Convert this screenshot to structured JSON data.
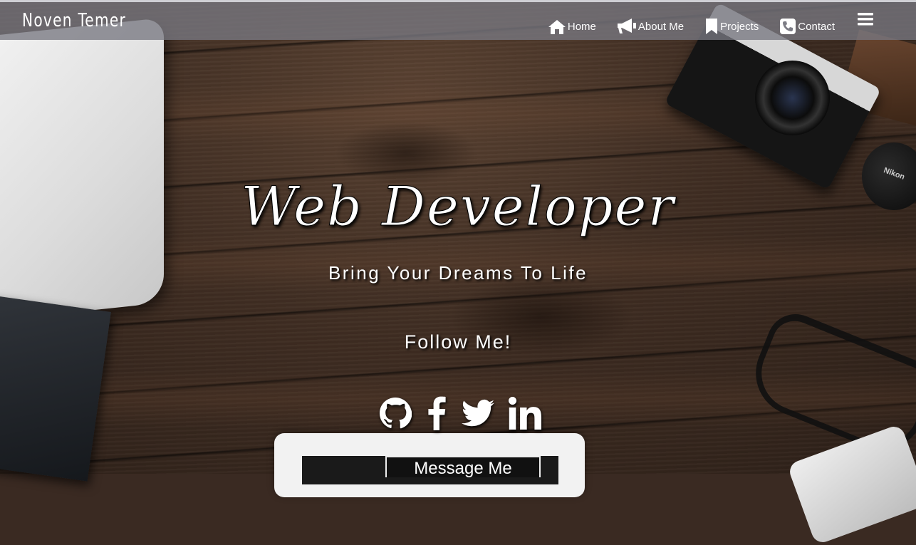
{
  "navbar": {
    "brand": "Noven Temer",
    "items": [
      {
        "label": "Home",
        "icon": "home-icon"
      },
      {
        "label": "About Me",
        "icon": "megaphone-icon"
      },
      {
        "label": "Projects",
        "icon": "bookmark-icon"
      },
      {
        "label": "Contact",
        "icon": "phone-icon"
      }
    ],
    "menu_icon": "hamburger-menu-icon"
  },
  "hero": {
    "title": "Web Developer",
    "subtitle": "Bring Your Dreams To Life",
    "follow": "Follow Me!",
    "socials": [
      "github-icon",
      "facebook-icon",
      "twitter-icon",
      "linkedin-icon"
    ],
    "cta": "Message Me"
  },
  "background": {
    "decor": "Nikon"
  }
}
